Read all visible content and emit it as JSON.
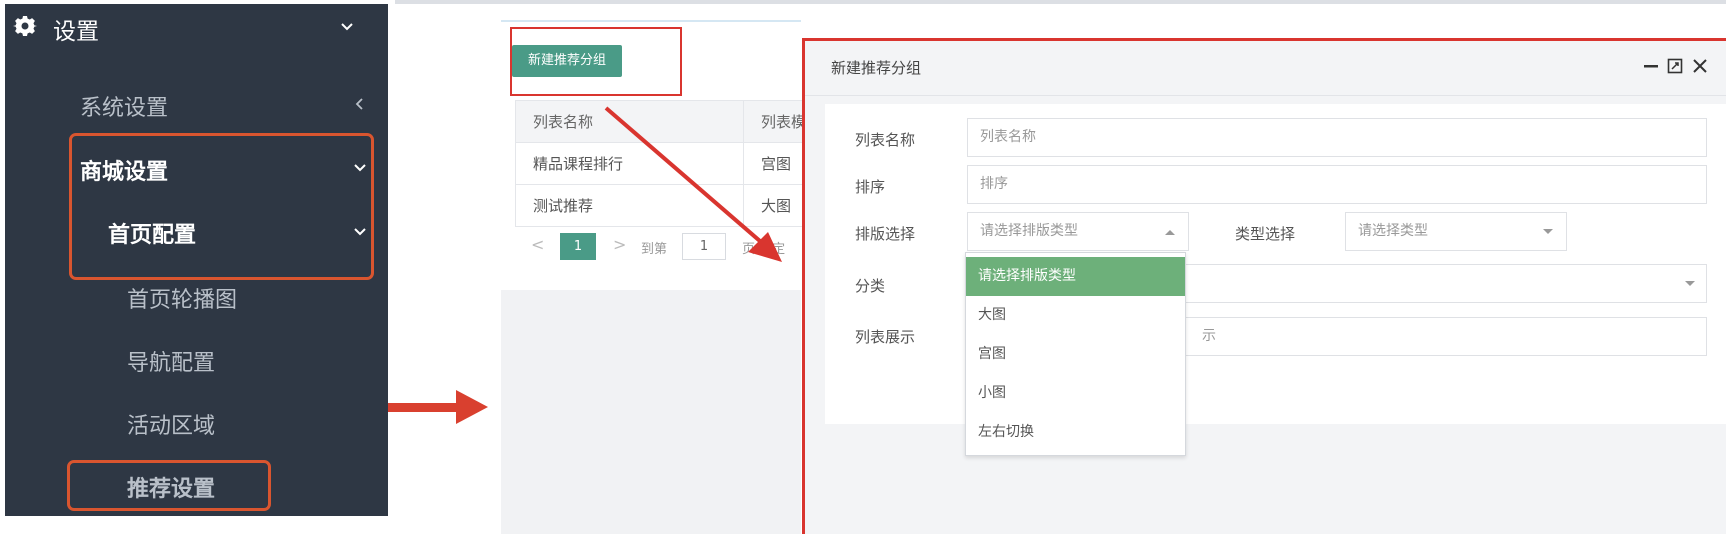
{
  "sidebar": {
    "settings_label": "设置",
    "items": [
      {
        "label": "系统设置"
      },
      {
        "label": "商城设置"
      },
      {
        "label": "首页配置"
      },
      {
        "label": "首页轮播图"
      },
      {
        "label": "导航配置"
      },
      {
        "label": "活动区域"
      },
      {
        "label": "推荐设置"
      }
    ]
  },
  "list": {
    "new_button": "新建推荐分组",
    "columns": [
      "列表名称",
      "列表模"
    ],
    "rows": [
      [
        "精品课程排行",
        "宫图"
      ],
      [
        "测试推荐",
        "大图"
      ]
    ],
    "pager": {
      "current": "1",
      "goto_label": "到第",
      "page_input": "1",
      "confirm": "页 确定"
    }
  },
  "modal": {
    "title": "新建推荐分组",
    "fields": {
      "name_label": "列表名称",
      "name_placeholder": "列表名称",
      "sort_label": "排序",
      "sort_placeholder": "排序",
      "layout_label": "排版选择",
      "layout_value": "请选择排版类型",
      "type_label": "类型选择",
      "type_value": "请选择类型",
      "category_label": "分类",
      "display_label": "列表展示",
      "display_partial": "示"
    },
    "dropdown": [
      "请选择排版类型",
      "大图",
      "宫图",
      "小图",
      "左右切换"
    ]
  },
  "colors": {
    "sidebar_bg": "#2e3744",
    "accent_green": "#4a9b87",
    "annotation_red": "#d9352f"
  }
}
